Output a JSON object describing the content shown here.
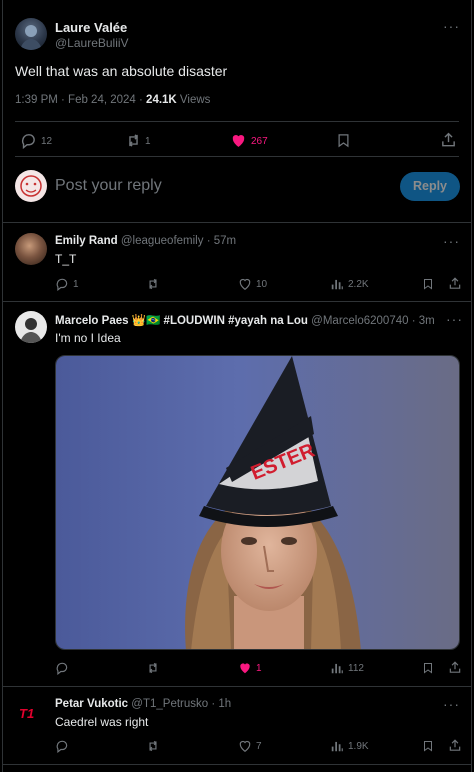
{
  "main_tweet": {
    "author_name": "Laure Valée",
    "author_handle": "@LaureBuliiV",
    "text": "Well that was an absolute disaster",
    "time": "1:39 PM · Feb 24, 2024 · ",
    "views_count": "24.1K",
    "views_label": " Views",
    "replies": "12",
    "reposts": "1",
    "likes": "267",
    "liked": true
  },
  "reply_box": {
    "placeholder": "Post your reply",
    "button_label": "Reply"
  },
  "replies": [
    {
      "name": "Emily Rand",
      "handle": "@leagueofemily",
      "time": "· 57m",
      "text": "T_T",
      "replies": "1",
      "reposts": "",
      "likes": "10",
      "views": "2.2K",
      "liked": false
    },
    {
      "name": "Marcelo Paes 👑🇧🇷 #LOUDWIN #yayah na Lou",
      "handle": "@Marcelo6200740",
      "time": "· 3m",
      "text": "I'm no I Idea",
      "replies": "",
      "reposts": "",
      "likes": "1",
      "views": "112",
      "liked": true,
      "media_alt": "GIF of a woman wearing a black 'DESTER' dunce cap"
    },
    {
      "name": "Petar Vukotic",
      "handle": "@T1_Petrusko",
      "time": "· 1h",
      "text": "Caedrel was right",
      "replies": "",
      "reposts": "",
      "likes": "7",
      "views": "1.9K",
      "liked": false
    }
  ],
  "colors": {
    "background": "#000000",
    "text": "#e7e9ea",
    "muted": "#71767b",
    "like": "#f91880",
    "reply_button": "#1d9bf0",
    "divider": "#2f3336"
  },
  "icons": [
    "more-icon",
    "reply-icon",
    "repost-icon",
    "like-icon",
    "bookmark-icon",
    "share-icon",
    "views-icon"
  ]
}
